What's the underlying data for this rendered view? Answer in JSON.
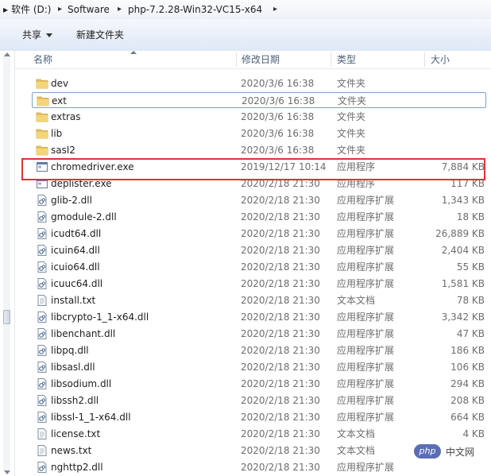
{
  "address": {
    "breadcrumbs": [
      "软件 (D:)",
      "Software",
      "php-7.2.28-Win32-VC15-x64"
    ]
  },
  "toolbar": {
    "share_label": "共享",
    "new_folder_label": "新建文件夹"
  },
  "columns": {
    "name": "名称",
    "date": "修改日期",
    "type": "类型",
    "size": "大小"
  },
  "files": [
    {
      "name": "dev",
      "date": "2020/3/6 16:38",
      "type": "文件夹",
      "size": "",
      "icon": "folder-icon"
    },
    {
      "name": "ext",
      "date": "2020/3/6 16:38",
      "type": "文件夹",
      "size": "",
      "icon": "folder-icon"
    },
    {
      "name": "extras",
      "date": "2020/3/6 16:38",
      "type": "文件夹",
      "size": "",
      "icon": "folder-icon"
    },
    {
      "name": "lib",
      "date": "2020/3/6 16:38",
      "type": "文件夹",
      "size": "",
      "icon": "folder-icon"
    },
    {
      "name": "sasl2",
      "date": "2020/3/6 16:38",
      "type": "文件夹",
      "size": "",
      "icon": "folder-icon"
    },
    {
      "name": "chromedriver.exe",
      "date": "2019/12/17 10:14",
      "type": "应用程序",
      "size": "7,884 KB",
      "icon": "exe-icon"
    },
    {
      "name": "deplister.exe",
      "date": "2020/2/18 21:30",
      "type": "应用程序",
      "size": "117 KB",
      "icon": "exe-icon"
    },
    {
      "name": "glib-2.dll",
      "date": "2020/2/18 21:30",
      "type": "应用程序扩展",
      "size": "1,343 KB",
      "icon": "dll-icon"
    },
    {
      "name": "gmodule-2.dll",
      "date": "2020/2/18 21:30",
      "type": "应用程序扩展",
      "size": "18 KB",
      "icon": "dll-icon"
    },
    {
      "name": "icudt64.dll",
      "date": "2020/2/18 21:30",
      "type": "应用程序扩展",
      "size": "26,889 KB",
      "icon": "dll-icon"
    },
    {
      "name": "icuin64.dll",
      "date": "2020/2/18 21:30",
      "type": "应用程序扩展",
      "size": "2,404 KB",
      "icon": "dll-icon"
    },
    {
      "name": "icuio64.dll",
      "date": "2020/2/18 21:30",
      "type": "应用程序扩展",
      "size": "55 KB",
      "icon": "dll-icon"
    },
    {
      "name": "icuuc64.dll",
      "date": "2020/2/18 21:30",
      "type": "应用程序扩展",
      "size": "1,581 KB",
      "icon": "dll-icon"
    },
    {
      "name": "install.txt",
      "date": "2020/2/18 21:30",
      "type": "文本文档",
      "size": "78 KB",
      "icon": "txt-icon"
    },
    {
      "name": "libcrypto-1_1-x64.dll",
      "date": "2020/2/18 21:30",
      "type": "应用程序扩展",
      "size": "3,342 KB",
      "icon": "dll-icon"
    },
    {
      "name": "libenchant.dll",
      "date": "2020/2/18 21:30",
      "type": "应用程序扩展",
      "size": "47 KB",
      "icon": "dll-icon"
    },
    {
      "name": "libpq.dll",
      "date": "2020/2/18 21:30",
      "type": "应用程序扩展",
      "size": "186 KB",
      "icon": "dll-icon"
    },
    {
      "name": "libsasl.dll",
      "date": "2020/2/18 21:30",
      "type": "应用程序扩展",
      "size": "106 KB",
      "icon": "dll-icon"
    },
    {
      "name": "libsodium.dll",
      "date": "2020/2/18 21:30",
      "type": "应用程序扩展",
      "size": "294 KB",
      "icon": "dll-icon"
    },
    {
      "name": "libssh2.dll",
      "date": "2020/2/18 21:30",
      "type": "应用程序扩展",
      "size": "208 KB",
      "icon": "dll-icon"
    },
    {
      "name": "libssl-1_1-x64.dll",
      "date": "2020/2/18 21:30",
      "type": "应用程序扩展",
      "size": "664 KB",
      "icon": "dll-icon"
    },
    {
      "name": "license.txt",
      "date": "2020/2/18 21:30",
      "type": "文本文档",
      "size": "4 KB",
      "icon": "txt-icon"
    },
    {
      "name": "news.txt",
      "date": "2020/2/18 21:30",
      "type": "文本文档",
      "size": "",
      "icon": "txt-icon"
    },
    {
      "name": "nghttp2.dll",
      "date": "2020/2/18 21:30",
      "type": "应用程序扩展",
      "size": "",
      "icon": "dll-icon"
    }
  ],
  "watermark": {
    "logo": "php",
    "text": "中文网"
  },
  "colors": {
    "highlight_border": "#e23232",
    "folder": "#e8c15a",
    "header_text": "#4c607a"
  }
}
